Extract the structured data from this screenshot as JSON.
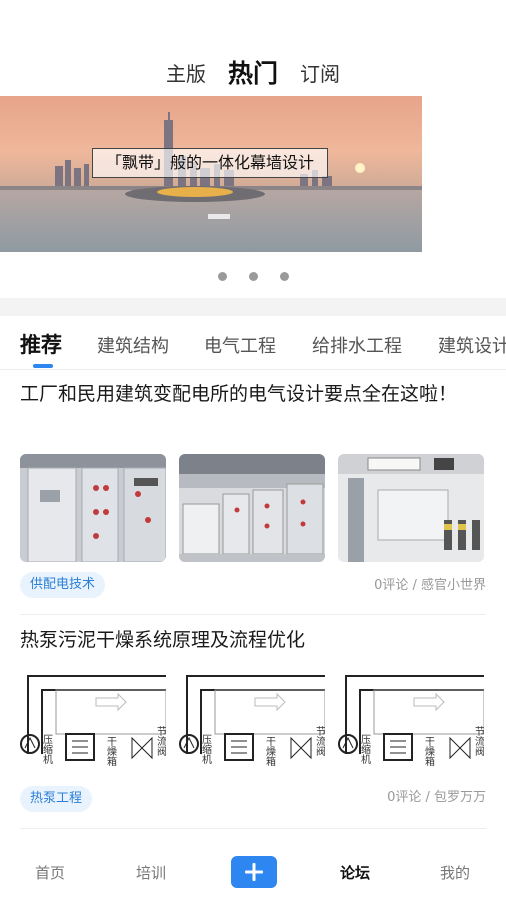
{
  "top_tabs": [
    {
      "label": "主版"
    },
    {
      "label": "热门",
      "active": true
    },
    {
      "label": "订阅"
    }
  ],
  "banner": {
    "caption": "「飘带」般的一体化幕墙设计",
    "slide_count": 3
  },
  "categories": [
    {
      "label": "推荐",
      "active": true
    },
    {
      "label": "建筑结构"
    },
    {
      "label": "电气工程"
    },
    {
      "label": "给排水工程"
    },
    {
      "label": "建筑设计"
    }
  ],
  "articles": [
    {
      "title": "工厂和民用建筑变配电所的电气设计要点全在这啦！",
      "tag": "供配电技术",
      "meta": "0评论 / 感官小世界"
    },
    {
      "title": "热泵污泥干燥系统原理及流程优化",
      "tag": "热泵工程",
      "meta": "0评论 / 包罗万万"
    }
  ],
  "diagram_labels": {
    "compressor": "压缩机",
    "dryer": "干燥箱",
    "throttle_valve": "节流阀"
  },
  "bottom_nav": [
    {
      "label": "首页"
    },
    {
      "label": "培训"
    },
    {
      "label": "论坛",
      "active": true
    },
    {
      "label": "我的"
    }
  ],
  "colors": {
    "accent": "#2e86f0",
    "tag_bg": "#e9f3fd",
    "tag_text": "#2b7fd6"
  },
  "icons": {
    "plus": "plus-icon"
  }
}
